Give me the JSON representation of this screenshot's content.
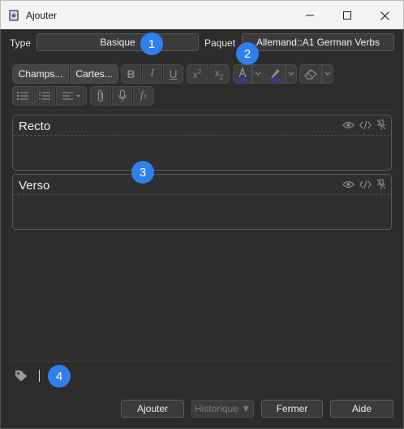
{
  "window": {
    "title": "Ajouter"
  },
  "top": {
    "type_label": "Type",
    "type_value": "Basique",
    "deck_label": "Paquet",
    "deck_value": "Allemand::A1 German Verbs"
  },
  "toolbar": {
    "fields_button": "Champs...",
    "cards_button": "Cartes..."
  },
  "fields": [
    {
      "name": "Recto"
    },
    {
      "name": "Verso"
    }
  ],
  "badges": [
    "1",
    "2",
    "3",
    "4"
  ],
  "bottom": {
    "add": "Ajouter",
    "history": "Historique ▼",
    "close": "Fermer",
    "help": "Aide"
  },
  "colors": {
    "background": "#2c2c2c",
    "badge": "#2f80ed",
    "text_color_underline": "#3030c8"
  }
}
